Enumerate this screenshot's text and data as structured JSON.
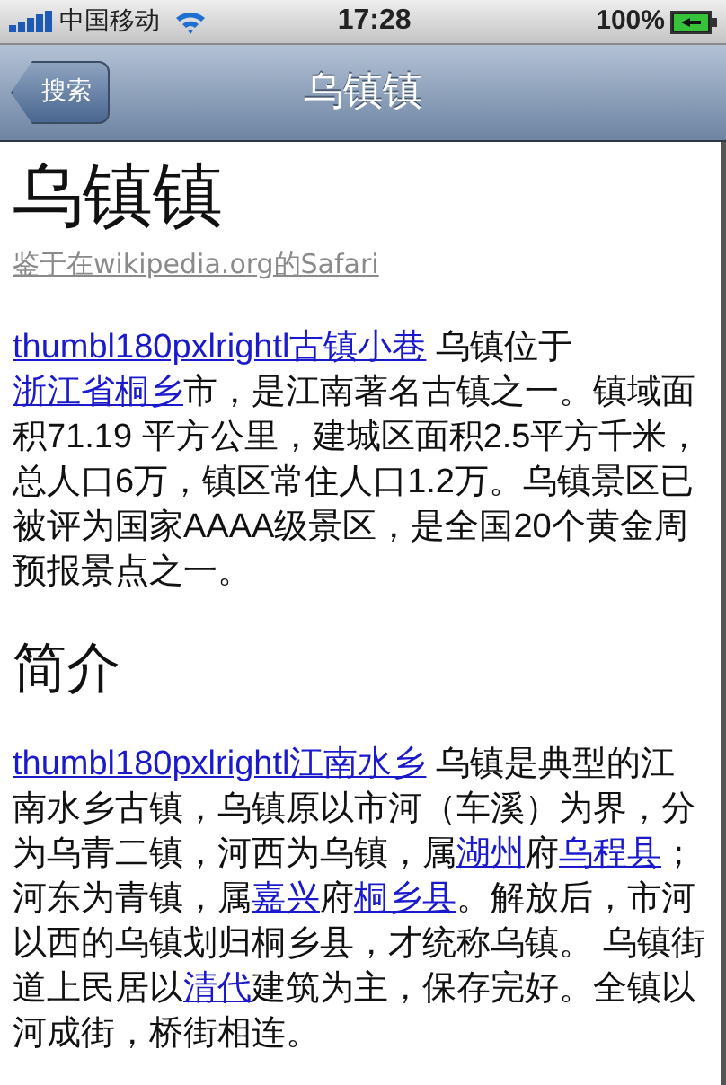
{
  "status_bar": {
    "carrier": "中国移动",
    "time": "17:28",
    "battery": "100%"
  },
  "nav_bar": {
    "back_button": "搜索",
    "title": "乌镇镇"
  },
  "article": {
    "title": "乌镇镇",
    "source": "鉴于在wikipedia.org的Safari",
    "sections": [
      {
        "kind": "paragraph",
        "segments": [
          {
            "text": "thumbl180pxlrightl古镇小巷",
            "link": true
          },
          {
            "text": " 乌镇位于",
            "link": false
          },
          {
            "text": "浙江省桐乡",
            "link": true
          },
          {
            "text": "市，是江南著名古镇之一。镇域面积71.19 平方公里，建城区面积2.5平方千米，总人口6万，镇区常住人口1.2万。乌镇景区已被评为国家AAAA级景区，是全国20个黄金周预报景点之一。",
            "link": false
          }
        ]
      },
      {
        "kind": "heading",
        "text": "简介"
      },
      {
        "kind": "paragraph",
        "segments": [
          {
            "text": "thumbl180pxlrightl江南水乡",
            "link": true
          },
          {
            "text": " 乌镇是典型的江南水乡古镇，乌镇原以市河（车溪）为界，分为乌青二镇，河西为乌镇，属",
            "link": false
          },
          {
            "text": "湖州",
            "link": true
          },
          {
            "text": "府",
            "link": false
          },
          {
            "text": "乌程县",
            "link": true
          },
          {
            "text": "；河东为青镇，属",
            "link": false
          },
          {
            "text": "嘉兴",
            "link": true
          },
          {
            "text": "府",
            "link": false
          },
          {
            "text": "桐乡县",
            "link": true
          },
          {
            "text": "。解放后，市河以西的乌镇划归桐乡县，才统称乌镇。 乌镇街道上民居以",
            "link": false
          },
          {
            "text": "清代",
            "link": true
          },
          {
            "text": "建筑为主，保存完好。全镇以河成街，桥街相连。",
            "link": false
          }
        ]
      }
    ]
  }
}
